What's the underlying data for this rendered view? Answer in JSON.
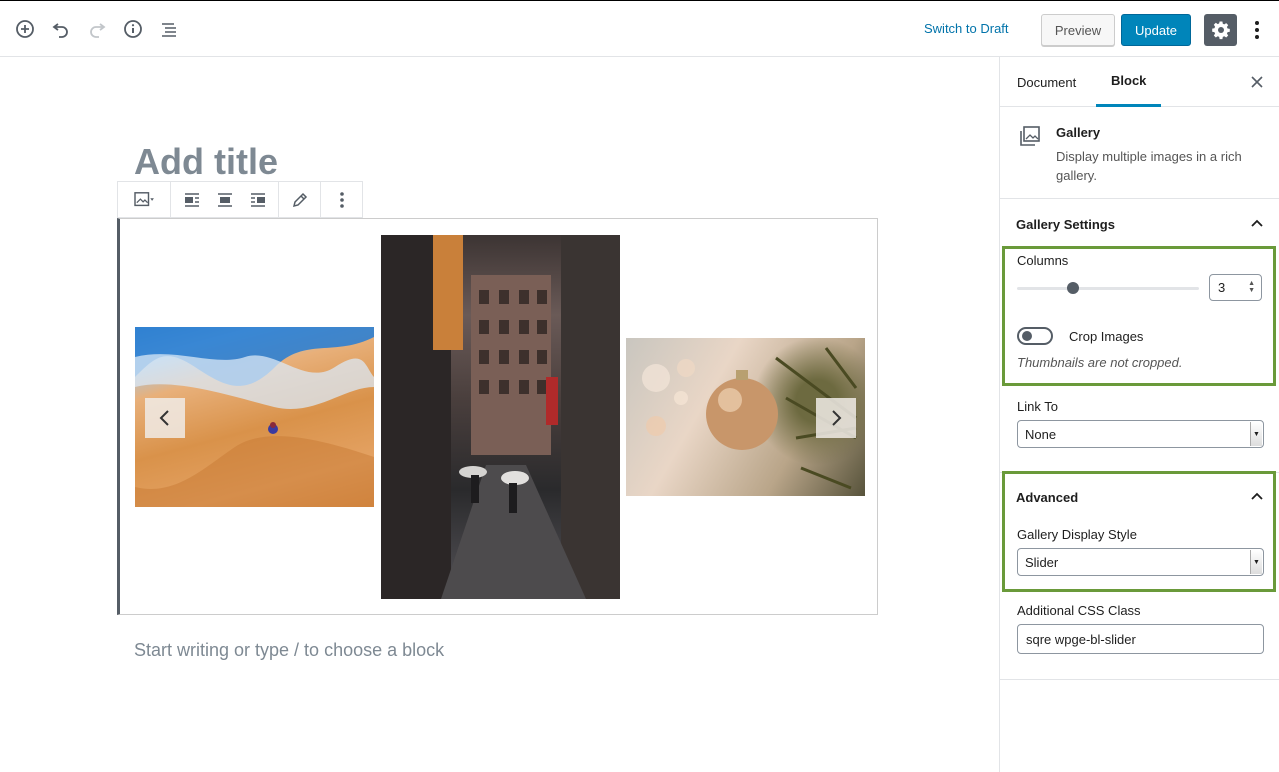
{
  "header": {
    "switch_to_draft": "Switch to Draft",
    "preview_label": "Preview",
    "update_label": "Update",
    "icons": [
      "add-block-icon",
      "undo-icon",
      "redo-icon",
      "info-icon",
      "outline-icon",
      "gear-icon",
      "more-vertical-icon"
    ]
  },
  "editor": {
    "title_placeholder": "Add title",
    "appender_placeholder": "Start writing or type / to choose a block",
    "block_toolbar_icons": [
      "gallery-icon",
      "align-left-icon",
      "align-center-icon",
      "align-right-icon",
      "edit-pencil-icon",
      "more-vertical-icon"
    ]
  },
  "sidebar": {
    "tabs": [
      "Document",
      "Block"
    ],
    "active_tab": "Block",
    "block": {
      "name": "Gallery",
      "description": "Display multiple images in a rich gallery."
    },
    "gallery_settings": {
      "title": "Gallery Settings",
      "columns_label": "Columns",
      "columns_value": "3",
      "crop_label": "Crop Images",
      "crop_help": "Thumbnails are not cropped.",
      "crop_on": false,
      "link_to_label": "Link To",
      "link_to_value": "None"
    },
    "advanced": {
      "title": "Advanced",
      "display_style_label": "Gallery Display Style",
      "display_style_value": "Slider",
      "css_class_label": "Additional CSS Class",
      "css_class_value": "sqre wpge-bl-slider"
    }
  },
  "colors": {
    "accent": "#0085ba",
    "highlight": "#6a9a3a"
  }
}
